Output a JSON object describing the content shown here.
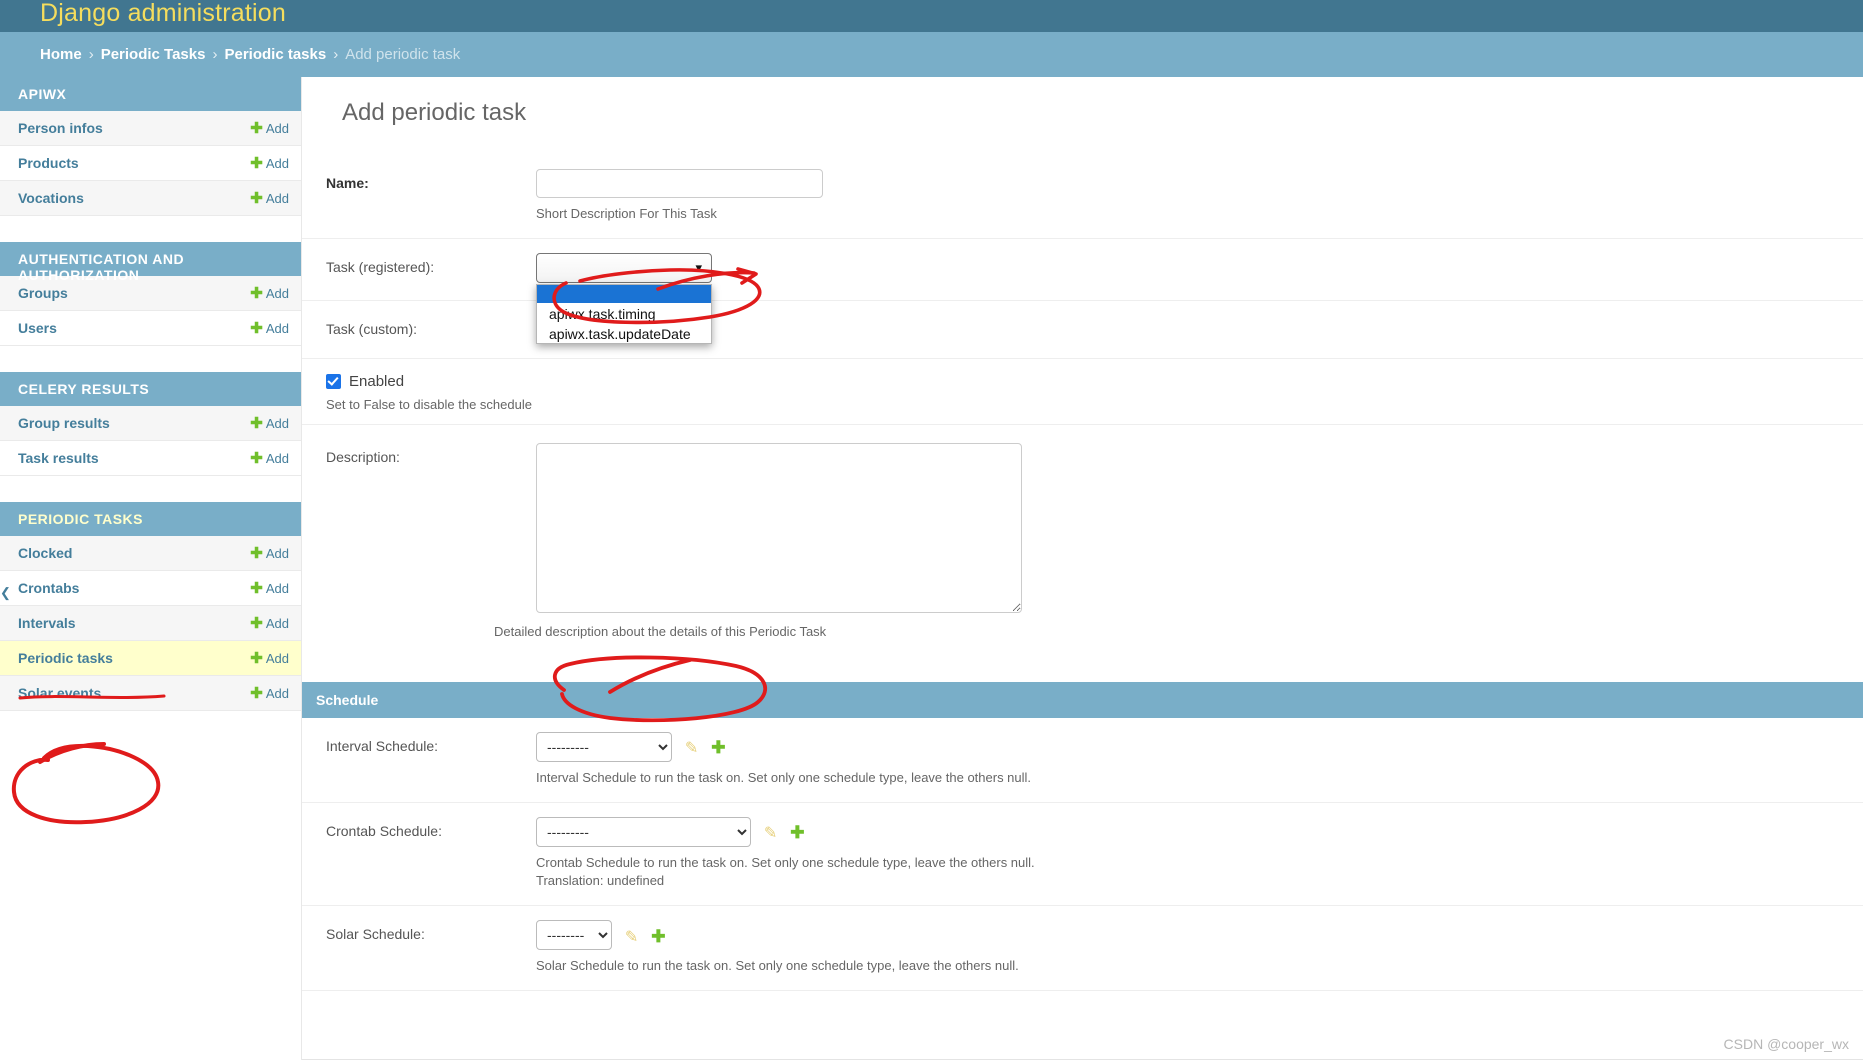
{
  "header": {
    "site_name": "Django administration"
  },
  "breadcrumbs": {
    "home": "Home",
    "app": "Periodic Tasks",
    "model": "Periodic tasks",
    "current": "Add periodic task",
    "separator": "›"
  },
  "sidebar": {
    "add_label": "Add",
    "apps": [
      {
        "name": "APIWX",
        "current": false,
        "models": [
          {
            "label": "Person infos",
            "add": "Add",
            "selected": false
          },
          {
            "label": "Products",
            "add": "Add",
            "selected": false
          },
          {
            "label": "Vocations",
            "add": "Add",
            "selected": false
          }
        ]
      },
      {
        "name": "AUTHENTICATION AND AUTHORIZATION",
        "current": false,
        "models": [
          {
            "label": "Groups",
            "add": "Add",
            "selected": false
          },
          {
            "label": "Users",
            "add": "Add",
            "selected": false
          }
        ]
      },
      {
        "name": "CELERY RESULTS",
        "current": false,
        "models": [
          {
            "label": "Group results",
            "add": "Add",
            "selected": false
          },
          {
            "label": "Task results",
            "add": "Add",
            "selected": false
          }
        ]
      },
      {
        "name": "PERIODIC TASKS",
        "current": true,
        "models": [
          {
            "label": "Clocked",
            "add": "Add",
            "selected": false
          },
          {
            "label": "Crontabs",
            "add": "Add",
            "selected": false
          },
          {
            "label": "Intervals",
            "add": "Add",
            "selected": false
          },
          {
            "label": "Periodic tasks",
            "add": "Add",
            "selected": true
          },
          {
            "label": "Solar events",
            "add": "Add",
            "selected": false
          }
        ]
      }
    ]
  },
  "main": {
    "title": "Add periodic task",
    "fields": {
      "name": {
        "label": "Name:",
        "value": "",
        "placeholder": "",
        "help": "Short Description For This Task"
      },
      "task_registered": {
        "label": "Task (registered):",
        "selected": "",
        "options": [
          "",
          "apiwx.task.timing",
          "apiwx.task.updateDate"
        ],
        "open": true
      },
      "task_custom": {
        "label": "Task (custom):",
        "value": ""
      },
      "enabled": {
        "label": "Enabled",
        "checked": true,
        "help": "Set to False to disable the schedule"
      },
      "description": {
        "label": "Description:",
        "value": "",
        "help": "Detailed description about the details of this Periodic Task"
      }
    },
    "schedule": {
      "title": "Schedule",
      "interval": {
        "label": "Interval Schedule:",
        "selected": "---------",
        "help": "Interval Schedule to run the task on. Set only one schedule type, leave the others null."
      },
      "crontab": {
        "label": "Crontab Schedule:",
        "selected": "---------",
        "help": "Crontab Schedule to run the task on. Set only one schedule type, leave the others null.",
        "help2": "Translation: undefined"
      },
      "solar": {
        "label": "Solar Schedule:",
        "selected": "--------",
        "help": "Solar Schedule to run the task on. Set only one schedule type, leave the others null."
      }
    }
  },
  "icons": {
    "pencil": "✎",
    "plus": "✚",
    "chevron_down": "⌄"
  },
  "watermark": "CSDN @cooper_wx",
  "colors": {
    "header_bg": "#417690",
    "header_text": "#f5dd5d",
    "breadcrumb_bg": "#79aec8",
    "module_header_bg": "#79aec8",
    "link": "#447e9b",
    "add_green": "#70bf2b",
    "selected_row": "#ffffcc",
    "annotation_red": "#e01b1b",
    "dropdown_highlight": "#1a73d4"
  }
}
